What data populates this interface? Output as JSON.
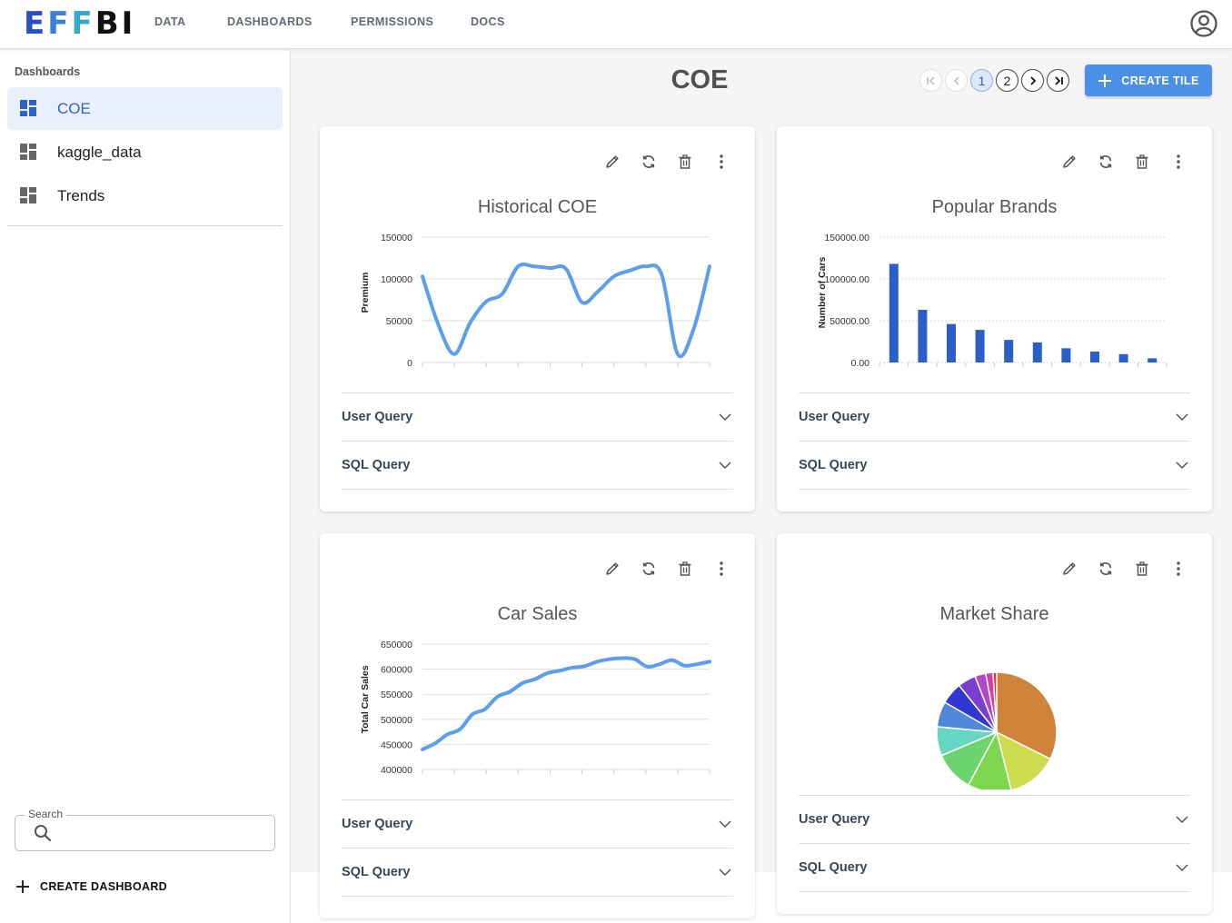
{
  "header": {
    "logo_letters": [
      "E",
      "F",
      "F",
      "B",
      "I"
    ],
    "nav": [
      "DATA",
      "DASHBOARDS",
      "PERMISSIONS",
      "DOCS"
    ]
  },
  "sidebar": {
    "title": "Dashboards",
    "items": [
      {
        "label": "COE",
        "active": true
      },
      {
        "label": "kaggle_data",
        "active": false
      },
      {
        "label": "Trends",
        "active": false
      }
    ],
    "search_label": "Search",
    "create_label": "CREATE DASHBOARD"
  },
  "main": {
    "title": "COE",
    "pages": [
      "1",
      "2"
    ],
    "current_page": "1",
    "create_tile_label": "CREATE TILE"
  },
  "accordion": {
    "user_query": "User Query",
    "sql_query": "SQL Query"
  },
  "colors": {
    "accent": "#4a90e8",
    "line_series": "#5b9ef0",
    "bar_series": "#2a5fc7"
  },
  "chart_data": [
    {
      "type": "line",
      "title": "Historical COE",
      "ylabel": "Premium",
      "ylim": [
        0,
        150000
      ],
      "yticks": [
        "150000",
        "100000",
        "50000",
        "0"
      ],
      "x": [
        0,
        1,
        2,
        3,
        4,
        5,
        6,
        7,
        8,
        9,
        10,
        11,
        12,
        13,
        14,
        15,
        16,
        17,
        18
      ],
      "values": [
        103000,
        45000,
        10000,
        48000,
        73000,
        82000,
        115000,
        115000,
        113000,
        112000,
        72000,
        85000,
        103000,
        110000,
        115000,
        105000,
        10000,
        40000,
        115000
      ]
    },
    {
      "type": "bar",
      "title": "Popular Brands",
      "ylabel": "Number of Cars",
      "ylim": [
        0,
        150000
      ],
      "yticks": [
        "150000.00",
        "100000.00",
        "50000.00",
        "0.00"
      ],
      "values": [
        118000,
        63000,
        46000,
        39000,
        27000,
        24000,
        17000,
        13000,
        10000,
        5000
      ]
    },
    {
      "type": "line",
      "title": "Car Sales",
      "ylabel": "Total Car Sales",
      "ylim": [
        400000,
        650000
      ],
      "yticks": [
        "650000",
        "600000",
        "550000",
        "500000",
        "450000",
        "400000"
      ],
      "values": [
        440000,
        452000,
        470000,
        480000,
        510000,
        520000,
        545000,
        555000,
        572000,
        580000,
        592000,
        597000,
        603000,
        606000,
        615000,
        620000,
        622000,
        620000,
        605000,
        610000,
        618000,
        607000,
        610000,
        615000
      ]
    },
    {
      "type": "pie",
      "title": "Market Share",
      "values": [
        33,
        14,
        12,
        11,
        8,
        7,
        6,
        5,
        3,
        2,
        1
      ],
      "colors": [
        "#d0843a",
        "#cddc4f",
        "#7dd64d",
        "#6cd46f",
        "#66d6c2",
        "#4f88d8",
        "#2f38d0",
        "#7a3fd0",
        "#b347c9",
        "#d43fa2",
        "#d23a45"
      ]
    }
  ]
}
